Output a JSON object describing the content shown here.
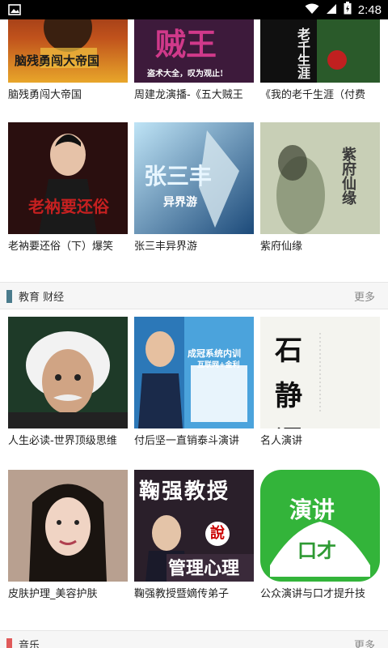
{
  "status_bar": {
    "time": "2:48",
    "icons": [
      "image-icon",
      "wifi-icon",
      "cell-signal-icon",
      "battery-icon"
    ]
  },
  "row1": {
    "items": [
      {
        "title": "脑残勇闯大帝国",
        "cover_text": "脑残勇闯大帝国"
      },
      {
        "title": "周建龙演播-《五大贼王",
        "cover_text": "贼王",
        "cover_subtext": "盗术大全，叹为观止!"
      },
      {
        "title": "《我的老千生涯（付费",
        "cover_text": "老千生涯"
      }
    ]
  },
  "row2": {
    "items": [
      {
        "title": "老衲要还俗（下）爆笑",
        "cover_text": "老衲要还俗"
      },
      {
        "title": "张三丰异界游",
        "cover_text": "张三丰",
        "cover_subtext": "异界游"
      },
      {
        "title": "紫府仙缘",
        "cover_text": "紫府仙缘"
      }
    ]
  },
  "section_education": {
    "title": "教育 财经",
    "more": "更多",
    "accent": "#4a7b8c"
  },
  "row3": {
    "items": [
      {
        "title": "人生必读-世界顶级思维"
      },
      {
        "title": "付后坚一直销泰斗演讲",
        "cover_text": "成冠系统内训",
        "cover_subtext": "互联网+金利"
      },
      {
        "title": "名人演讲",
        "cover_text": "石 静 语 聽"
      }
    ]
  },
  "row4": {
    "items": [
      {
        "title": "皮肤护理_美容护肤"
      },
      {
        "title": "鞠强教授暨嫡传弟子",
        "cover_text": "鞠强教授",
        "cover_subtext": "管理心理",
        "badge": "說"
      },
      {
        "title": "公众演讲与口才提升技",
        "cover_text": "演讲",
        "cover_subtext": "口才"
      }
    ]
  },
  "section_music": {
    "title": "音乐",
    "more": "更多",
    "accent": "#e05a5a"
  }
}
